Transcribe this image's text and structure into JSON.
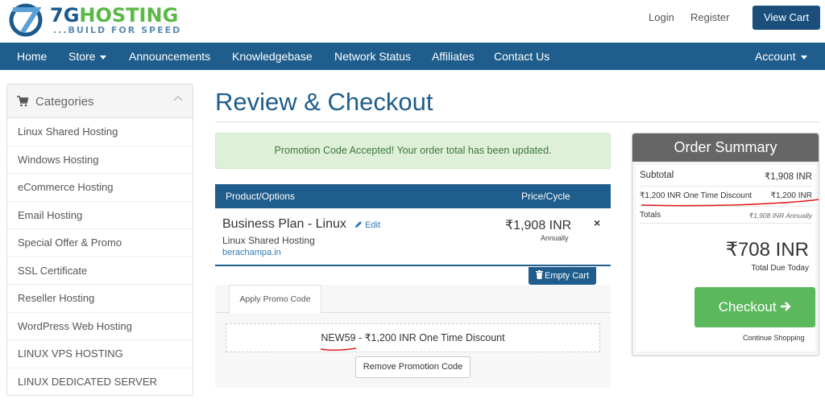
{
  "header": {
    "logo_brand_a": "7G",
    "logo_brand_b": "HOSTING",
    "logo_tagline": "...BUILD FOR SPEED",
    "login": "Login",
    "register": "Register",
    "view_cart": "View Cart"
  },
  "nav": {
    "home": "Home",
    "store": "Store",
    "announcements": "Announcements",
    "knowledgebase": "Knowledgebase",
    "network_status": "Network Status",
    "affiliates": "Affiliates",
    "contact_us": "Contact Us",
    "account": "Account"
  },
  "sidebar": {
    "title": "Categories",
    "items": [
      "Linux Shared Hosting",
      "Windows Hosting",
      "eCommerce Hosting",
      "Email Hosting",
      "Special Offer & Promo",
      "SSL Certificate",
      "Reseller Hosting",
      "WordPress Web Hosting",
      "LINUX VPS HOSTING",
      "LINUX DEDICATED SERVER"
    ]
  },
  "main": {
    "title": "Review & Checkout",
    "alert": "Promotion Code Accepted! Your order total has been updated.",
    "table": {
      "col_product": "Product/Options",
      "col_price": "Price/Cycle"
    },
    "item": {
      "name": "Business Plan - Linux",
      "edit": "Edit",
      "group": "Linux Shared Hosting",
      "domain": "berachampa.in",
      "price": "₹1,908 INR",
      "cycle": "Annually",
      "remove": "×"
    },
    "empty_cart": "Empty Cart",
    "promo": {
      "tab": "Apply Promo Code",
      "applied": "NEW59 - ₹1,200 INR One Time Discount",
      "remove": "Remove Promotion Code"
    }
  },
  "summary": {
    "title": "Order Summary",
    "subtotal_label": "Subtotal",
    "subtotal_value": "₹1,908 INR",
    "discount_label": "₹1,200 INR One Time Discount",
    "discount_value": "₹1,200 INR",
    "totals_label": "Totals",
    "totals_value": "₹1,908 INR Annually",
    "total_due": "₹708 INR",
    "total_due_label": "Total Due Today",
    "checkout": "Checkout",
    "continue": "Continue Shopping"
  },
  "colors": {
    "brand_blue": "#1f5d8c",
    "brand_green": "#5ab946",
    "checkout_green": "#5cb85c",
    "alert_bg": "#dff0d8",
    "annotation_red": "#e31b1b"
  }
}
